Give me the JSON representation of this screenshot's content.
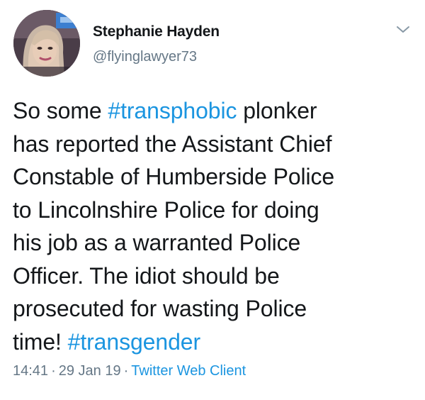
{
  "tweet": {
    "author": {
      "name": "Stephanie Hayden",
      "handle": "@flyinglawyer73"
    },
    "text_lines": [
      [
        {
          "t": "So some ",
          "tag": false
        },
        {
          "t": "#transphobic",
          "tag": true
        },
        {
          "t": " plonker",
          "tag": false
        }
      ],
      [
        {
          "t": "has reported the Assistant Chief",
          "tag": false
        }
      ],
      [
        {
          "t": "Constable of Humberside Police",
          "tag": false
        }
      ],
      [
        {
          "t": "to Lincolnshire Police for doing",
          "tag": false
        }
      ],
      [
        {
          "t": "his job as a warranted Police",
          "tag": false
        }
      ],
      [
        {
          "t": "Officer. The idiot should be",
          "tag": false
        }
      ],
      [
        {
          "t": "prosecuted for wasting Police",
          "tag": false
        }
      ],
      [
        {
          "t": "time! ",
          "tag": false
        },
        {
          "t": "#transgender",
          "tag": true
        }
      ]
    ],
    "time": "14:41",
    "date": "29 Jan 19",
    "separator": "·",
    "source": "Twitter Web Client"
  },
  "icons": {
    "menu": "chevron-down-icon"
  },
  "colors": {
    "text": "#14171a",
    "secondary": "#657786",
    "link": "#1b95e0",
    "background": "#ffffff"
  }
}
